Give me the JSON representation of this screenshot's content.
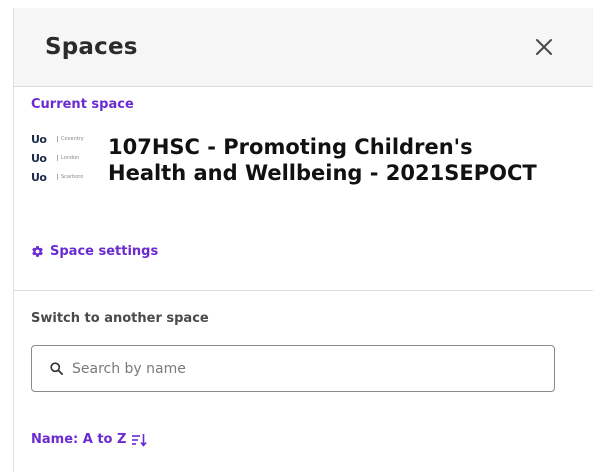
{
  "header": {
    "title": "Spaces",
    "close_icon": "close-icon"
  },
  "current": {
    "label": "Current space",
    "space_name": "107HSC - Promoting Children's Health and Wellbeing - 2021SEPOCT",
    "logo": {
      "rows": [
        {
          "mark": "Uo",
          "city": "Coventry"
        },
        {
          "mark": "Uo",
          "city": "London"
        },
        {
          "mark": "Uo",
          "city": "Scarboro"
        }
      ]
    },
    "settings_label": "Space settings",
    "settings_icon": "gear-icon"
  },
  "switch": {
    "label": "Switch to another space",
    "search_placeholder": "Search by name",
    "search_value": "",
    "search_icon": "search-icon"
  },
  "sort": {
    "label": "Name: A to Z",
    "icon": "sort-descending-icon"
  },
  "colors": {
    "accent": "#6b2bd1",
    "header_bg": "#f6f6f6",
    "divider": "#dcdcdc"
  }
}
